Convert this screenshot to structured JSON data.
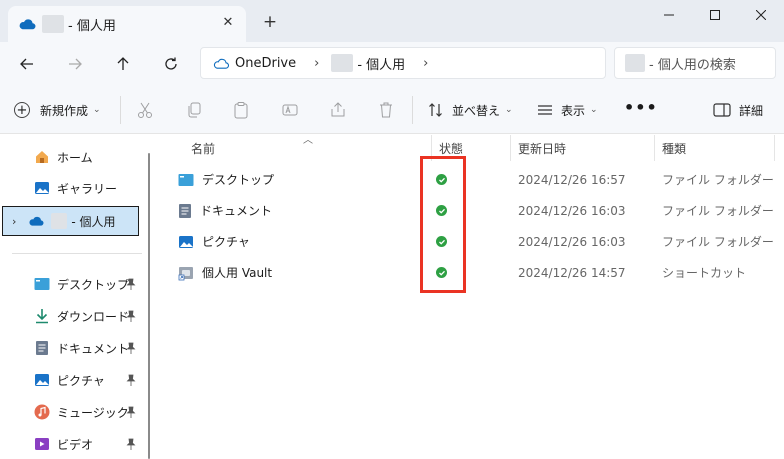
{
  "window": {
    "tab_title": "- 個人用",
    "tab_close": "✕",
    "new_tab": "+"
  },
  "address": {
    "root": "OneDrive",
    "sep1": "›",
    "folder": "- 個人用",
    "sep2": "›",
    "search_placeholder": "- 個人用の検索"
  },
  "toolbar": {
    "new_label": "新規作成",
    "sort_label": "並べ替え",
    "view_label": "表示",
    "more_label": "•••",
    "details_label": "詳細",
    "chevron": "⌄"
  },
  "sidebar": {
    "home": "ホーム",
    "gallery": "ギャラリー",
    "onedrive": "- 個人用",
    "quick_access": [
      {
        "label": "デスクトップ"
      },
      {
        "label": "ダウンロード"
      },
      {
        "label": "ドキュメント"
      },
      {
        "label": "ピクチャ"
      },
      {
        "label": "ミュージック"
      },
      {
        "label": "ビデオ"
      }
    ],
    "pin_glyph": "📌"
  },
  "columns": {
    "name": "名前",
    "status": "状態",
    "modified": "更新日時",
    "type": "種類"
  },
  "files": [
    {
      "name": "デスクトップ",
      "modified": "2024/12/26 16:57",
      "type": "ファイル フォルダー",
      "status": "synced"
    },
    {
      "name": "ドキュメント",
      "modified": "2024/12/26 16:03",
      "type": "ファイル フォルダー",
      "status": "synced"
    },
    {
      "name": "ピクチャ",
      "modified": "2024/12/26 16:03",
      "type": "ファイル フォルダー",
      "status": "synced"
    },
    {
      "name": "個人用 Vault",
      "modified": "2024/12/26 14:57",
      "type": "ショートカット",
      "status": "synced"
    }
  ],
  "colors": {
    "accent": "#0067c0",
    "selected_bg": "#cce4f7",
    "status_green": "#2ea043",
    "highlight_red": "#ea3323"
  }
}
